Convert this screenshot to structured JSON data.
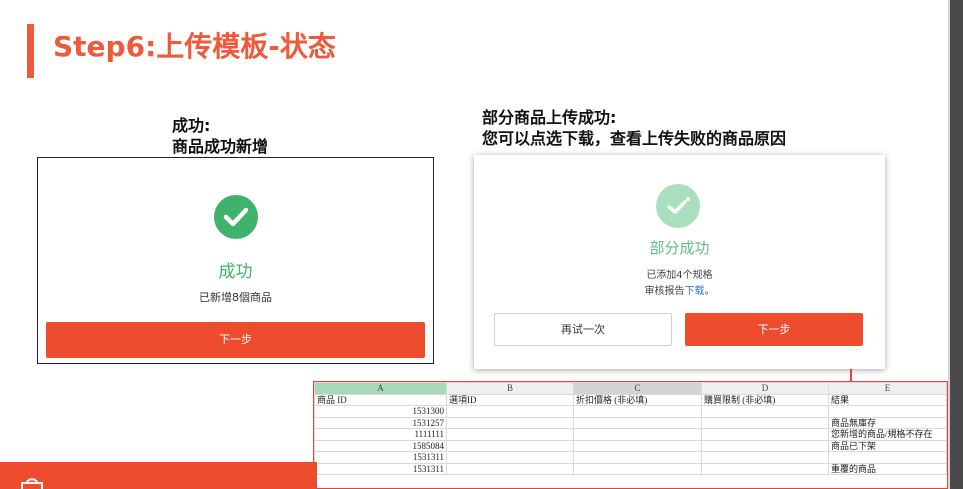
{
  "page": {
    "title": "Step6:上传模板-状态",
    "accent_color": "#ef5a3a"
  },
  "left": {
    "caption_line1": "成功:",
    "caption_line2": "商品成功新增",
    "icon": "check-circle-icon",
    "status_title": "成功",
    "status_sub": "已新增8個商品",
    "next_label": "下一步",
    "success_color": "#3fb36b"
  },
  "right": {
    "caption_line1": "部分商品上传成功:",
    "caption_line2": "您可以点选下载，查看上传失败的商品原因",
    "icon": "partial-check-icon",
    "status_title": "部分成功",
    "sub_line1": "已添加4个规格",
    "sub_line2_prefix": "审核报告",
    "sub_line2_link": "下载",
    "sub_line2_suffix": "。",
    "retry_label": "再试一次",
    "next_label": "下一步"
  },
  "sheet": {
    "columns": [
      "A",
      "B",
      "C",
      "D",
      "E"
    ],
    "headers": [
      "商品 ID",
      "選項ID",
      "折扣價格 (非必填)",
      "購買限制 (非必填)",
      "結果"
    ],
    "rows": [
      [
        "1531300",
        "",
        "",
        "",
        ""
      ],
      [
        "1531257",
        "",
        "",
        "",
        "商品無庫存"
      ],
      [
        "1111111",
        "",
        "",
        "",
        "您新增的商品/規格不存在"
      ],
      [
        "1585084",
        "",
        "",
        "",
        "商品已下架"
      ],
      [
        "1531311",
        "",
        "",
        "",
        ""
      ],
      [
        "1531311",
        "",
        "",
        "",
        "重覆的商品"
      ]
    ]
  }
}
